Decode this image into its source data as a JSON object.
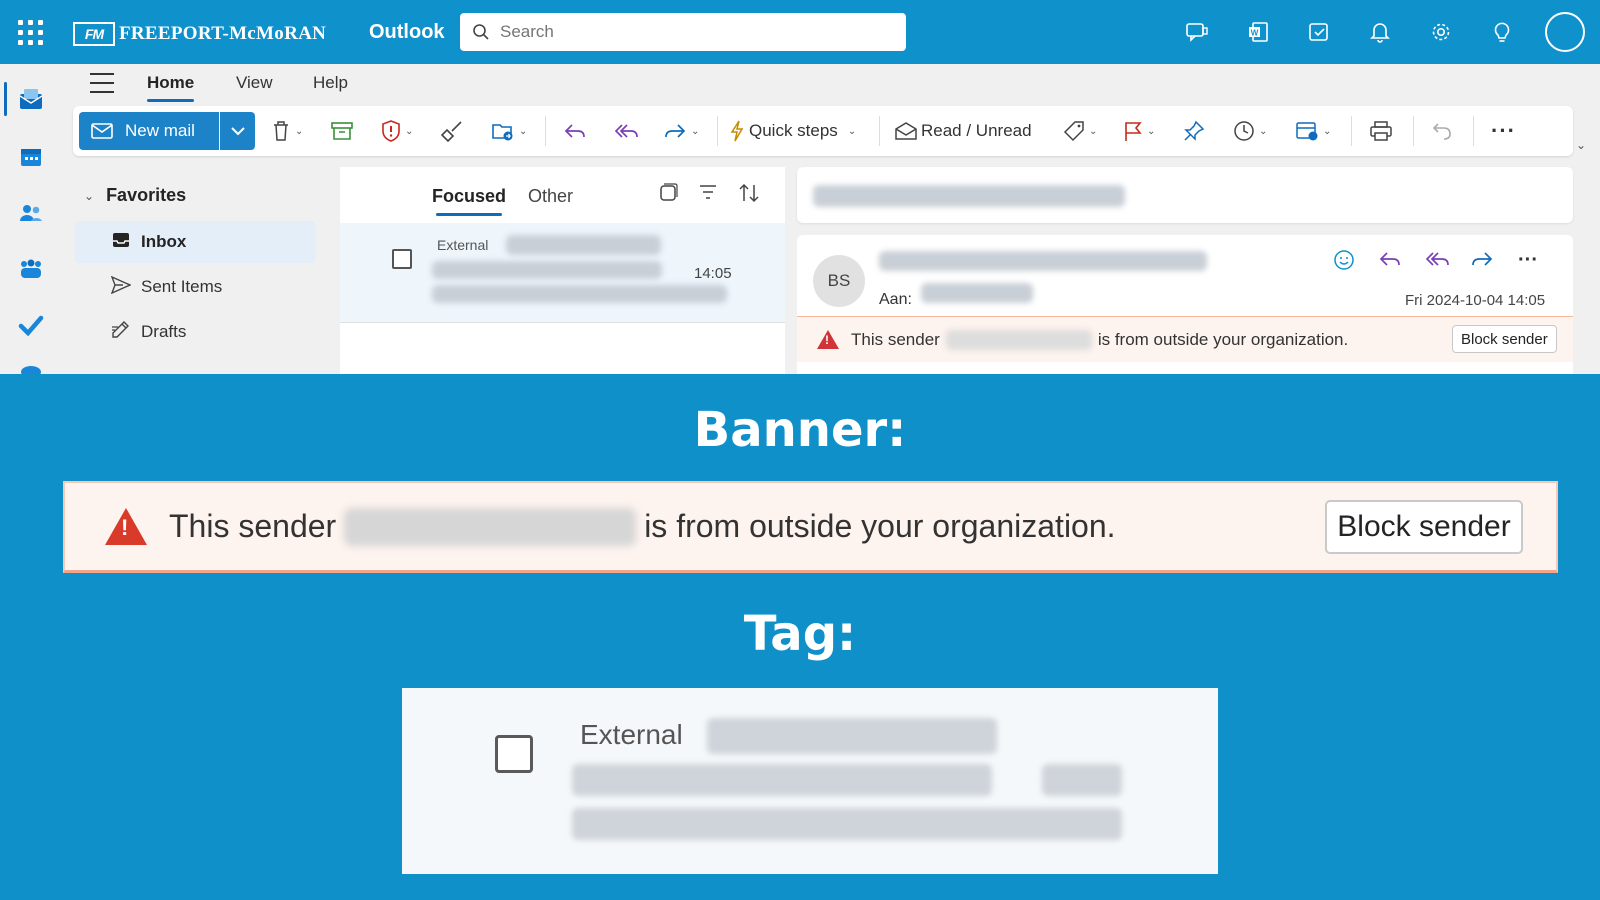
{
  "topbar": {
    "logo_mark": "FM",
    "logo_text": "FREEPORT-McMoRAN",
    "app_name": "Outlook",
    "search_placeholder": "Search",
    "icons": [
      "teams-chat-icon",
      "word-icon",
      "todo-icon",
      "bell-icon",
      "gear-icon",
      "lightbulb-icon"
    ]
  },
  "rail": {
    "items": [
      "mail-icon",
      "calendar-icon",
      "people-icon",
      "groups-icon",
      "todo-check-icon",
      "onedrive-icon"
    ]
  },
  "menu": {
    "tabs": [
      "Home",
      "View",
      "Help"
    ],
    "active": "Home"
  },
  "ribbon": {
    "new_mail": "New mail",
    "quick_steps": "Quick steps",
    "read_unread": "Read / Unread"
  },
  "folders": {
    "favorites_label": "Favorites",
    "items": [
      {
        "label": "Inbox",
        "icon": "inbox-icon"
      },
      {
        "label": "Sent Items",
        "icon": "send-icon"
      },
      {
        "label": "Drafts",
        "icon": "drafts-icon"
      }
    ]
  },
  "message_list": {
    "tabs": [
      "Focused",
      "Other"
    ],
    "active_tab": "Focused",
    "message": {
      "tag": "External",
      "time": "14:05"
    }
  },
  "reading_pane": {
    "sender_initials": "BS",
    "to_label": "Aan:",
    "date": "Fri 2024-10-04 14:05",
    "banner_prefix": "This sender",
    "banner_suffix": "is from outside your organization.",
    "block_sender": "Block sender"
  },
  "annotations": {
    "banner_heading": "Banner:",
    "tag_heading": "Tag:"
  },
  "big_banner": {
    "prefix": "This sender",
    "suffix": "is from outside your organization.",
    "button": "Block sender"
  },
  "tag_example": {
    "tag": "External"
  },
  "colors": {
    "background": "#0f90c8",
    "topbar": "#0f91cc",
    "accent": "#0f6cbd",
    "banner_bg": "#fdf3ef",
    "warning_red": "#d13438"
  }
}
